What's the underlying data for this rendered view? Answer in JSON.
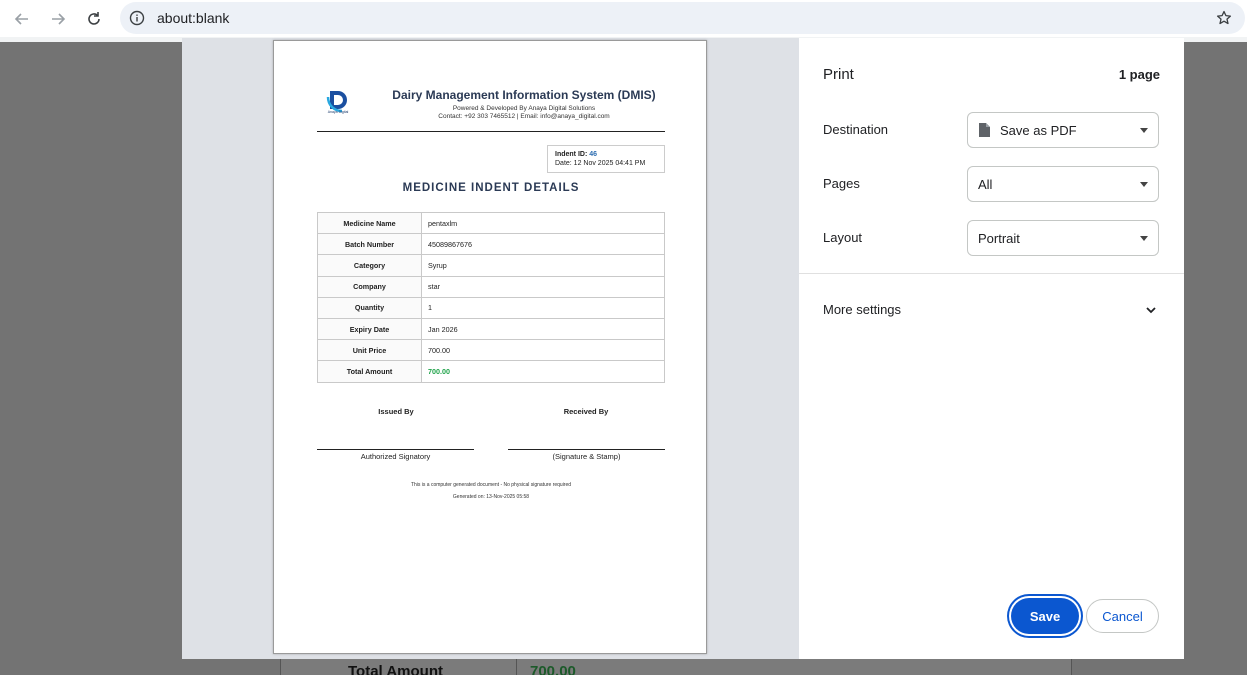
{
  "browser": {
    "url": "about:blank",
    "icons": [
      "back-arrow-icon",
      "forward-arrow-icon",
      "reload-icon",
      "info-icon",
      "star-icon"
    ]
  },
  "background_page": {
    "total_label": "Total Amount",
    "total_value": "700.00"
  },
  "document": {
    "logo_text": "Anaya Digital",
    "title": "Dairy Management Information System (DMIS)",
    "powered": "Powered & Developed By Anaya Digital Solutions",
    "contact": "Contact: +92 303 7465512 | Email: info@anaya_digital.com",
    "indent_id_label": "Indent ID:",
    "indent_id_value": "46",
    "date_line": "Date: 12 Nov 2025 04:41 PM",
    "section_title": "MEDICINE INDENT DETAILS",
    "rows": [
      {
        "label": "Medicine Name",
        "value": "pentaxlm"
      },
      {
        "label": "Batch Number",
        "value": "45089867676"
      },
      {
        "label": "Category",
        "value": "Syrup"
      },
      {
        "label": "Company",
        "value": "star"
      },
      {
        "label": "Quantity",
        "value": "1"
      },
      {
        "label": "Expiry Date",
        "value": "Jan 2026"
      },
      {
        "label": "Unit Price",
        "value": "700.00"
      },
      {
        "label": "Total Amount",
        "value": "700.00"
      }
    ],
    "issued_by": "Issued By",
    "received_by": "Received By",
    "issued_caption": "Authorized Signatory",
    "received_caption": "(Signature & Stamp)",
    "note": "This is a computer generated document - No physical signature required",
    "generated": "Generated on: 13-Nov-2025 05:58"
  },
  "print": {
    "title": "Print",
    "page_count": "1 page",
    "destination_label": "Destination",
    "destination_value": "Save as PDF",
    "pages_label": "Pages",
    "pages_value": "All",
    "layout_label": "Layout",
    "layout_value": "Portrait",
    "more_settings": "More settings",
    "save_label": "Save",
    "cancel_label": "Cancel"
  },
  "colors": {
    "accent": "#0b57d0",
    "total_green": "#1fa34a",
    "indent_id_blue": "#2b6cb0"
  }
}
